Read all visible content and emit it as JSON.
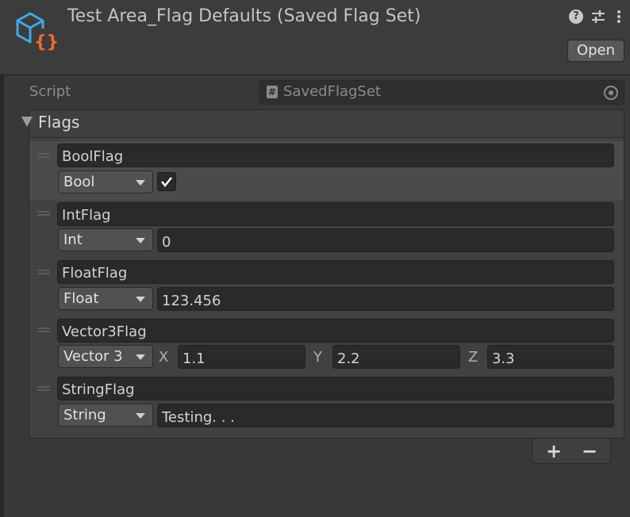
{
  "header": {
    "title": "Test Area_Flag Defaults (Saved Flag Set)",
    "help_icon": "question-circle-icon",
    "settings_icon": "sliders-icon",
    "menu_icon": "kebab-menu-icon",
    "open_label": "Open",
    "asset_icon": "scriptable-object-icon"
  },
  "script": {
    "label": "Script",
    "value": "SavedFlagSet",
    "hash_glyph": "#"
  },
  "flags": {
    "label": "Flags",
    "items": [
      {
        "name": "BoolFlag",
        "type": "Bool",
        "checked": true
      },
      {
        "name": "IntFlag",
        "type": "Int",
        "value": "0"
      },
      {
        "name": "FloatFlag",
        "type": "Float",
        "value": "123.456"
      },
      {
        "name": "Vector3Flag",
        "type": "Vector 3",
        "x_label": "X",
        "x": "1.1",
        "y_label": "Y",
        "y": "2.2",
        "z_label": "Z",
        "z": "3.3"
      },
      {
        "name": "StringFlag",
        "type": "String",
        "value": "Testing. . ."
      }
    ],
    "add_label": "+",
    "remove_label": "−"
  },
  "colors": {
    "background": "#383838",
    "field": "#2a2a2a",
    "selected_row": "#4b4b4b",
    "icon_blue": "#3fa9e6",
    "icon_orange": "#f06a2a"
  }
}
